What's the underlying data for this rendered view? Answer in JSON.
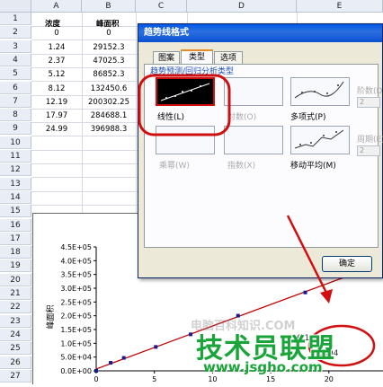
{
  "spreadsheet": {
    "columns": [
      "A",
      "B",
      "C",
      "D",
      "E"
    ],
    "rows": [
      "1",
      "2",
      "3",
      "4",
      "5",
      "6",
      "7",
      "8",
      "9",
      "10",
      "11",
      "12",
      "13",
      "14",
      "15",
      "16",
      "17",
      "18",
      "19",
      "20",
      "21",
      "22",
      "23",
      "24",
      "25",
      "26",
      "27"
    ],
    "headers": {
      "a": "浓度",
      "b": "峰面积"
    },
    "data": [
      [
        "0",
        "0"
      ],
      [
        "1.24",
        "29152.3"
      ],
      [
        "2.37",
        "47025.3"
      ],
      [
        "5.12",
        "86852.3"
      ],
      [
        "8.12",
        "132450.6"
      ],
      [
        "12.19",
        "200302.25"
      ],
      [
        "17.97",
        "284688.1"
      ],
      [
        "24.99",
        "396988.3"
      ]
    ]
  },
  "chart_data": {
    "type": "scatter",
    "x": [
      0,
      1.24,
      2.37,
      5.12,
      8.12,
      12.19,
      17.97,
      24.99
    ],
    "y": [
      0,
      29152.3,
      47025.3,
      86852.3,
      132450.6,
      200302.25,
      284688.1,
      396988.3
    ],
    "ylabel": "峰面积",
    "ytick_labels": [
      "0.0E+00",
      "5.0E+04",
      "1.0E+05",
      "1.5E+05",
      "2.0E+05",
      "2.5E+05",
      "3.0E+05",
      "3.5E+05",
      "4.0E+05",
      "4.5E+05"
    ],
    "xtick_labels": [
      "0",
      "5",
      "10",
      "15",
      "20"
    ],
    "ylim": [
      0,
      450000
    ],
    "trendline": "linear",
    "trendline_color": "#c00000",
    "marker_color": "#1a1a8c",
    "equation_fragment": "6.1",
    "r2_fragment": "0.9994"
  },
  "dialog": {
    "title": "趋势线格式",
    "tabs": [
      "图案",
      "类型",
      "选项"
    ],
    "section_label": "趋势预测/回归分析类型",
    "types": [
      "线性(L)",
      "对数(O)",
      "多项式(P)",
      "乘幂(W)",
      "指数(X)",
      "移动平均(M)"
    ],
    "order_label": "阶数(D):",
    "order_value": "2",
    "period_label": "周期(E):",
    "period_value": "2",
    "ok_label": "确定"
  },
  "watermark": {
    "site_faint": "电脑百科知识.COM",
    "brand": "技术员联盟",
    "url": "www.jsgho.com"
  },
  "colors": {
    "annotation_red": "#d01010",
    "title_blue": "#0058e6",
    "brand_green": "#1aa53a"
  }
}
